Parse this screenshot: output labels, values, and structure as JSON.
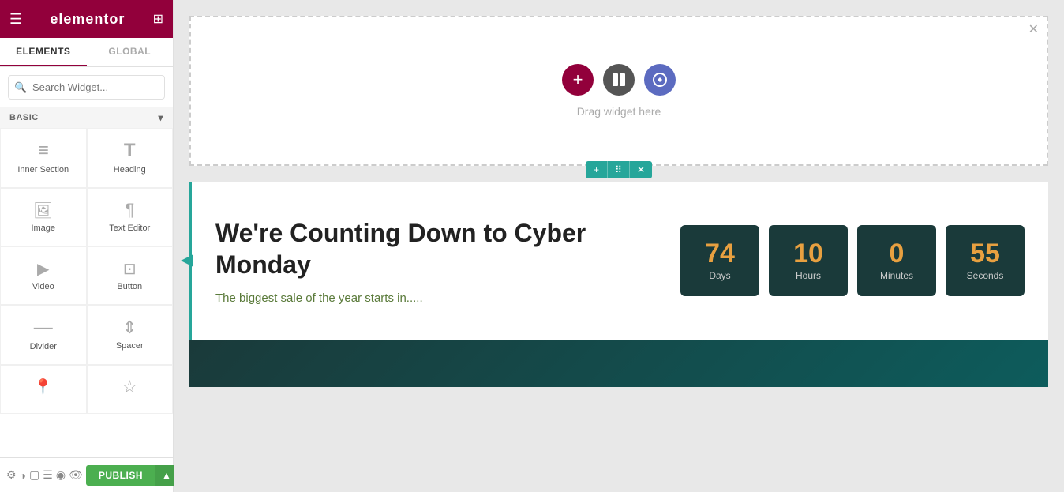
{
  "app": {
    "title": "elementor",
    "hamburger_icon": "☰",
    "grid_icon": "⊞"
  },
  "sidebar": {
    "tabs": [
      {
        "id": "elements",
        "label": "ELEMENTS",
        "active": true
      },
      {
        "id": "global",
        "label": "GLOBAL",
        "active": false
      }
    ],
    "search": {
      "placeholder": "Search Widget..."
    },
    "section_label": "BASIC",
    "widgets": [
      {
        "id": "inner-section",
        "label": "Inner Section",
        "icon": "icon-lines"
      },
      {
        "id": "heading",
        "label": "Heading",
        "icon": "icon-heading"
      },
      {
        "id": "image",
        "label": "Image",
        "icon": "icon-image"
      },
      {
        "id": "text-editor",
        "label": "Text Editor",
        "icon": "icon-text"
      },
      {
        "id": "video",
        "label": "Video",
        "icon": "icon-video"
      },
      {
        "id": "button",
        "label": "Button",
        "icon": "icon-button"
      },
      {
        "id": "divider",
        "label": "Divider",
        "icon": "icon-divider"
      },
      {
        "id": "spacer",
        "label": "Spacer",
        "icon": "icon-spacer"
      },
      {
        "id": "widget9",
        "label": "",
        "icon": "icon-map"
      },
      {
        "id": "widget10",
        "label": "",
        "icon": "icon-star"
      }
    ],
    "bottom_icons": [
      "⚙",
      "◑",
      "▢",
      "☰",
      "◉",
      "👁"
    ],
    "publish_label": "PUBLISH",
    "publish_arrow": "▲"
  },
  "canvas": {
    "drop_zone": {
      "drag_text": "Drag widget here",
      "close_icon": "✕"
    },
    "section_controls": [
      {
        "icon": "+",
        "title": "add"
      },
      {
        "icon": "⠿",
        "title": "move"
      },
      {
        "icon": "✕",
        "title": "delete"
      }
    ],
    "countdown": {
      "title": "We're Counting Down to Cyber Monday",
      "subtitle": "The biggest sale of the year starts in.....",
      "boxes": [
        {
          "value": "74",
          "unit": "Days"
        },
        {
          "value": "10",
          "unit": "Hours"
        },
        {
          "value": "0",
          "unit": "Minutes"
        },
        {
          "value": "55",
          "unit": "Seconds"
        }
      ]
    }
  }
}
